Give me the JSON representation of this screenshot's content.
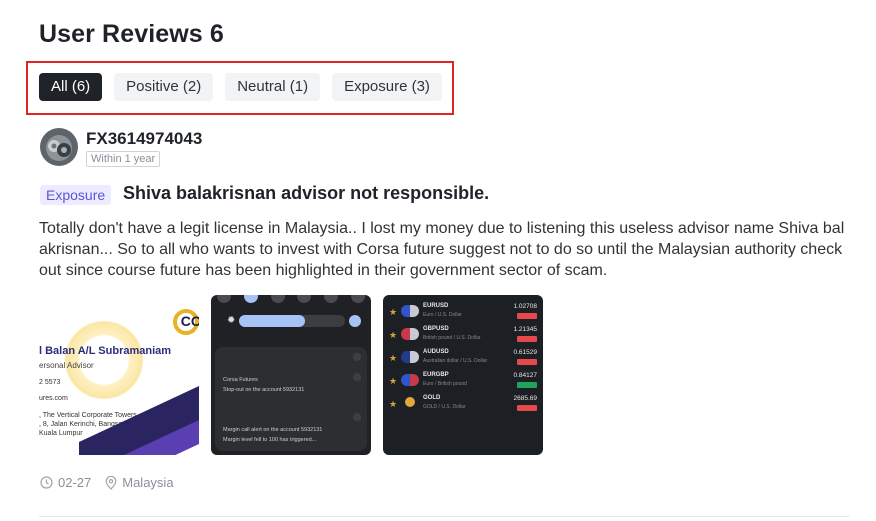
{
  "header": {
    "title": "User Reviews 6"
  },
  "filters": [
    {
      "label": "All (6)",
      "active": true
    },
    {
      "label": "Positive (2)",
      "active": false
    },
    {
      "label": "Neutral (1)",
      "active": false
    },
    {
      "label": "Exposure (3)",
      "active": false
    }
  ],
  "review": {
    "username": "FX3614974043",
    "time_badge": "Within 1 year",
    "tag": "Exposure",
    "title": "Shiva balakrisnan advisor not responsible.",
    "body": "Totally don't have a legit license in Malaysia.. I lost my money due to listening this useless advisor name Shiva balakrisnan... So to all who wants to invest with Corsa future suggest not to do so until the Malaysian authority check out since course future has been highlighted in their government sector of scam.",
    "date": "02-27",
    "location": "Malaysia",
    "images": {
      "card": {
        "logo_text": "CC",
        "name": "l Balan A/L Subramaniam",
        "role": "ersonal Advisor",
        "lines": [
          "2 5573",
          "ures.com",
          ", The Vertical Corporate Towers,",
          ", 8, Jalan Kerinchi, Bangsar South,",
          "Kuala Lumpur"
        ]
      },
      "phone": {
        "lines": [
          "Corsa Futures",
          "Stop-out on the account 5932131",
          "Margin call alert on the account 5932131",
          "Margin level fell to 100 has triggered..."
        ]
      },
      "fx": [
        {
          "pair": "EURUSD",
          "desc": "Euro / U.S. Dollar",
          "price": "1.02708",
          "up": false
        },
        {
          "pair": "GBPUSD",
          "desc": "British pound / U.S. Dollar",
          "price": "1.21345",
          "up": false
        },
        {
          "pair": "AUDUSD",
          "desc": "Australian dollar / U.S. Dollar",
          "price": "0.61529",
          "up": false
        },
        {
          "pair": "EURGBP",
          "desc": "Euro / British pound",
          "price": "0.84127",
          "up": true
        },
        {
          "pair": "GOLD",
          "desc": "GOLD / U.S. Dollar",
          "price": "2685.69",
          "up": false
        }
      ]
    }
  }
}
